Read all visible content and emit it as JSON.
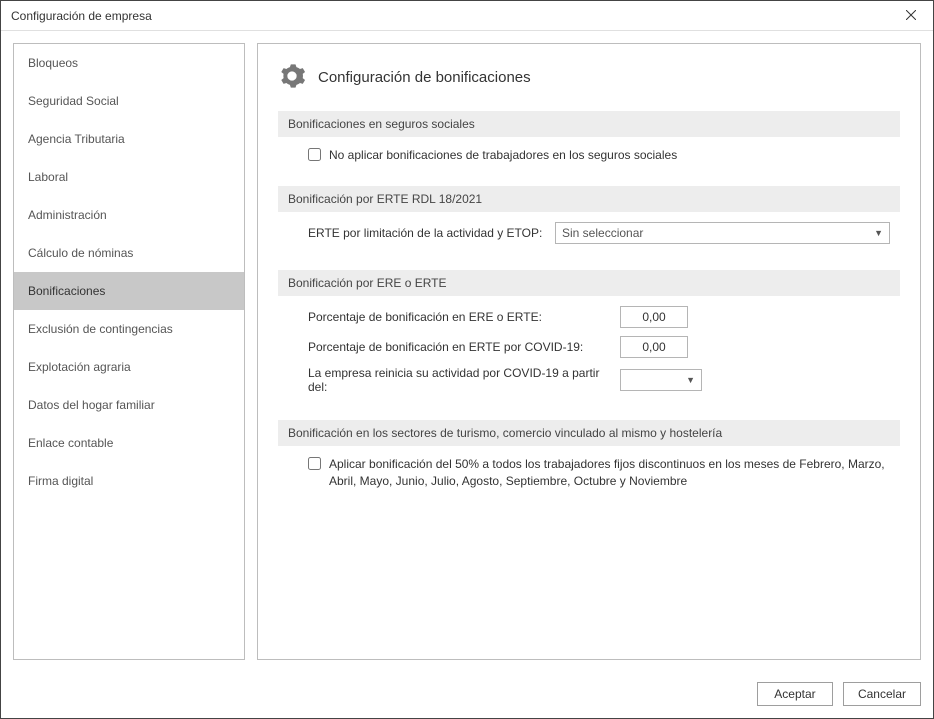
{
  "window": {
    "title": "Configuración de empresa"
  },
  "sidebar": {
    "items": [
      {
        "label": "Bloqueos",
        "selected": false
      },
      {
        "label": "Seguridad Social",
        "selected": false
      },
      {
        "label": "Agencia Tributaria",
        "selected": false
      },
      {
        "label": "Laboral",
        "selected": false
      },
      {
        "label": "Administración",
        "selected": false
      },
      {
        "label": "Cálculo de nóminas",
        "selected": false
      },
      {
        "label": "Bonificaciones",
        "selected": true
      },
      {
        "label": "Exclusión de contingencias",
        "selected": false
      },
      {
        "label": "Explotación agraria",
        "selected": false
      },
      {
        "label": "Datos del hogar familiar",
        "selected": false
      },
      {
        "label": "Enlace contable",
        "selected": false
      },
      {
        "label": "Firma digital",
        "selected": false
      }
    ]
  },
  "main": {
    "title": "Configuración de bonificaciones",
    "sections": {
      "seguros": {
        "header": "Bonificaciones en seguros sociales",
        "checkbox_label": "No aplicar bonificaciones de trabajadores en los seguros sociales",
        "checkbox_checked": false
      },
      "erte_rdl": {
        "header": "Bonificación por ERTE RDL 18/2021",
        "field_label": "ERTE por limitación de la actividad y ETOP:",
        "select_value": "Sin seleccionar"
      },
      "ere_erte": {
        "header": "Bonificación por ERE o ERTE",
        "pct_ere_label": "Porcentaje de bonificación en ERE o ERTE:",
        "pct_ere_value": "0,00",
        "pct_covid_label": "Porcentaje de bonificación en ERTE por COVID-19:",
        "pct_covid_value": "0,00",
        "restart_label": "La empresa reinicia su actividad por COVID-19 a partir del:",
        "restart_value": ""
      },
      "turismo": {
        "header": "Bonificación en los sectores de turismo, comercio vinculado al mismo y hostelería",
        "checkbox_label": "Aplicar bonificación del 50% a todos los trabajadores fijos discontinuos en los meses de Febrero, Marzo, Abril, Mayo, Junio, Julio, Agosto, Septiembre, Octubre y Noviembre",
        "checkbox_checked": false
      }
    }
  },
  "footer": {
    "accept": "Aceptar",
    "cancel": "Cancelar"
  }
}
